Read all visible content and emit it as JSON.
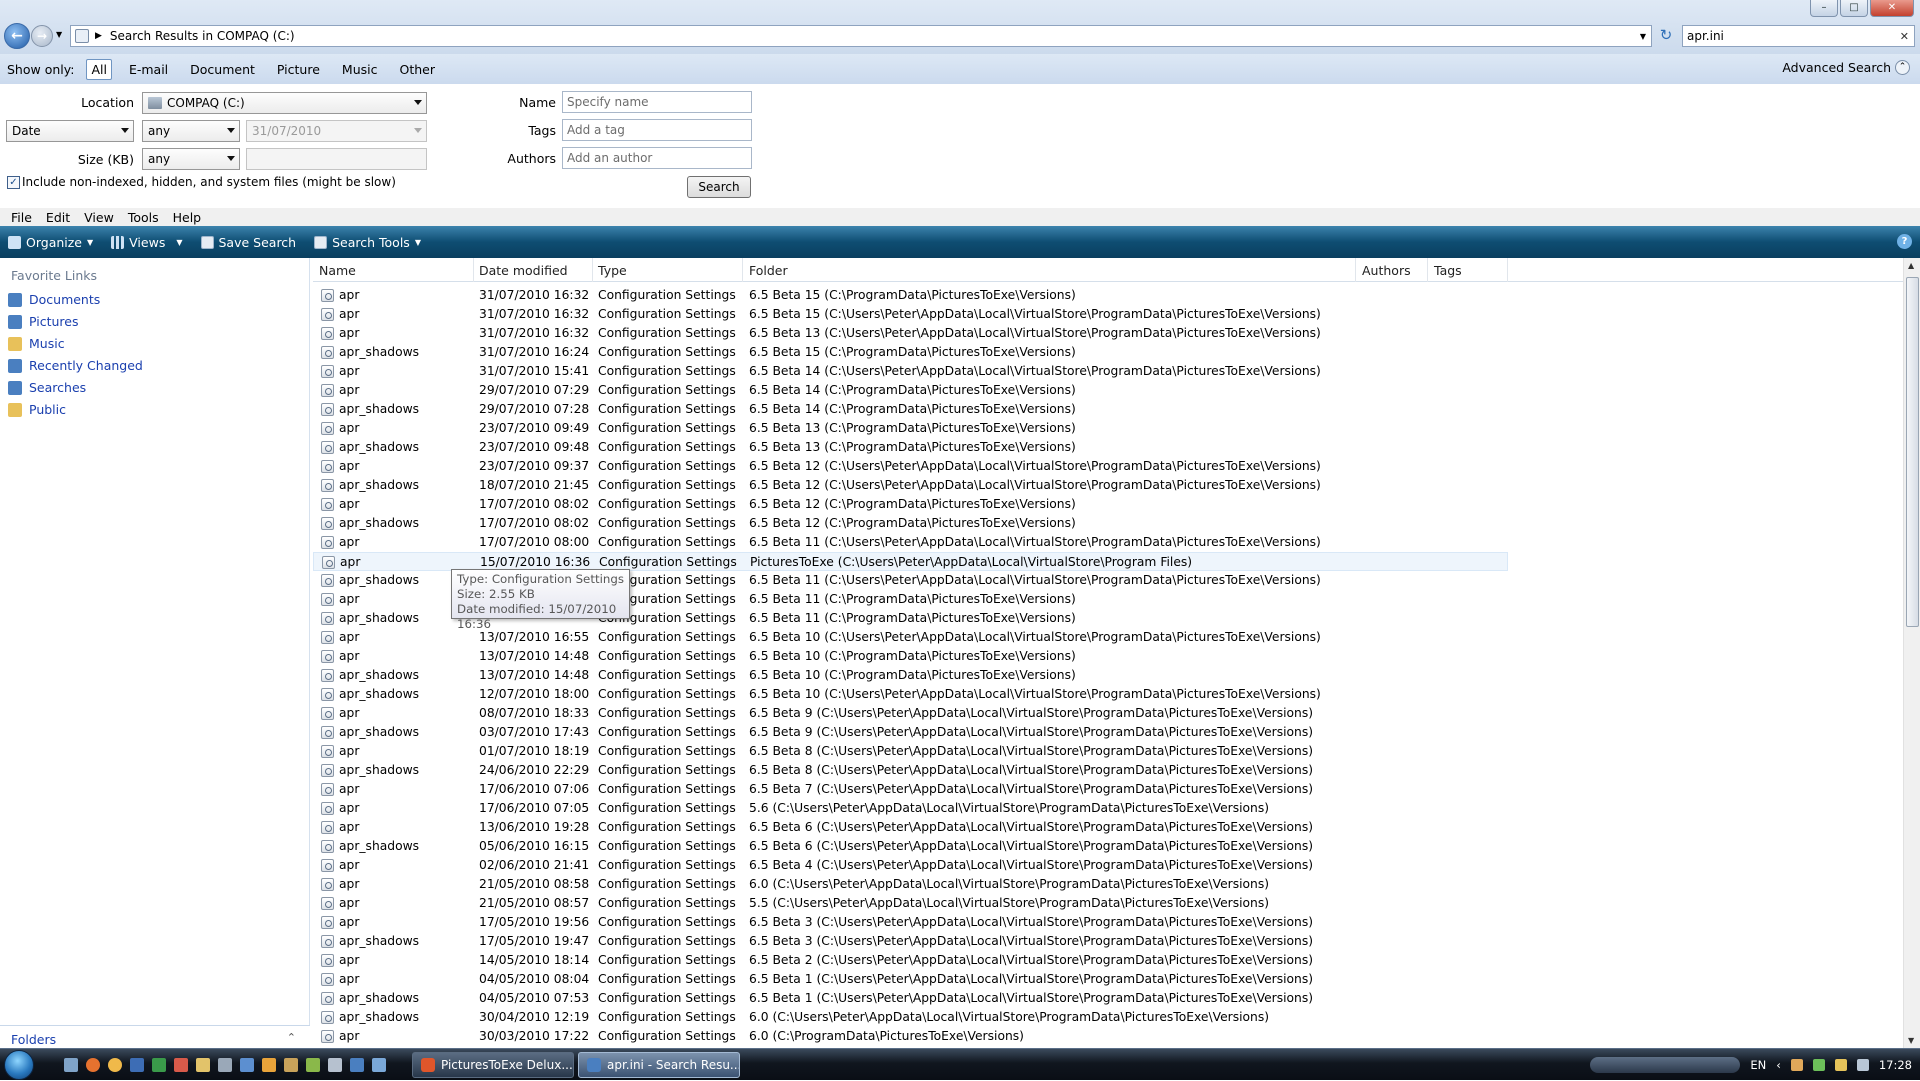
{
  "window": {
    "title": "Search Results in COMPAQ (C:)",
    "search_query": "apr.ini"
  },
  "filters": {
    "label": "Show only:",
    "items": [
      "All",
      "E-mail",
      "Document",
      "Picture",
      "Music",
      "Other"
    ],
    "selected": "All",
    "advanced": "Advanced Search"
  },
  "advanced": {
    "location_label": "Location",
    "location_value": "COMPAQ (C:)",
    "date_field": "Date",
    "date_op": "any",
    "date_value": "31/07/2010",
    "size_label": "Size (KB)",
    "size_op": "any",
    "size_value": "",
    "checkbox_label": "Include non-indexed, hidden, and system files (might be slow)",
    "checkbox_checked": true,
    "name_label": "Name",
    "name_placeholder": "Specify name",
    "tags_label": "Tags",
    "tags_placeholder": "Add a tag",
    "authors_label": "Authors",
    "authors_placeholder": "Add an author",
    "search_button": "Search"
  },
  "menu": [
    "File",
    "Edit",
    "View",
    "Tools",
    "Help"
  ],
  "toolbar": {
    "organize": "Organize",
    "views": "Views",
    "save_search": "Save Search",
    "search_tools": "Search Tools"
  },
  "sidebar": {
    "heading": "Favorite Links",
    "items": [
      {
        "label": "Documents",
        "icon": "documents-icon",
        "color": "#4a7fc0"
      },
      {
        "label": "Pictures",
        "icon": "pictures-icon",
        "color": "#4a7fc0"
      },
      {
        "label": "Music",
        "icon": "music-icon",
        "color": "#e8c15a"
      },
      {
        "label": "Recently Changed",
        "icon": "recently-changed-icon",
        "color": "#4a7fc0"
      },
      {
        "label": "Searches",
        "icon": "searches-icon",
        "color": "#4a7fc0"
      },
      {
        "label": "Public",
        "icon": "public-folder-icon",
        "color": "#e8c15a"
      }
    ],
    "folders": "Folders"
  },
  "columns": [
    "Name",
    "Date modified",
    "Type",
    "Folder",
    "Authors",
    "Tags"
  ],
  "rows": [
    {
      "name": "apr",
      "date": "31/07/2010 16:32",
      "type": "Configuration Settings",
      "folder": "6.5 Beta 15 (C:\\ProgramData\\PicturesToExe\\Versions)"
    },
    {
      "name": "apr",
      "date": "31/07/2010 16:32",
      "type": "Configuration Settings",
      "folder": "6.5 Beta 15 (C:\\Users\\Peter\\AppData\\Local\\VirtualStore\\ProgramData\\PicturesToExe\\Versions)"
    },
    {
      "name": "apr",
      "date": "31/07/2010 16:32",
      "type": "Configuration Settings",
      "folder": "6.5 Beta 13 (C:\\Users\\Peter\\AppData\\Local\\VirtualStore\\ProgramData\\PicturesToExe\\Versions)"
    },
    {
      "name": "apr_shadows",
      "date": "31/07/2010 16:24",
      "type": "Configuration Settings",
      "folder": "6.5 Beta 15 (C:\\ProgramData\\PicturesToExe\\Versions)"
    },
    {
      "name": "apr",
      "date": "31/07/2010 15:41",
      "type": "Configuration Settings",
      "folder": "6.5 Beta 14 (C:\\Users\\Peter\\AppData\\Local\\VirtualStore\\ProgramData\\PicturesToExe\\Versions)"
    },
    {
      "name": "apr",
      "date": "29/07/2010 07:29",
      "type": "Configuration Settings",
      "folder": "6.5 Beta 14 (C:\\ProgramData\\PicturesToExe\\Versions)"
    },
    {
      "name": "apr_shadows",
      "date": "29/07/2010 07:28",
      "type": "Configuration Settings",
      "folder": "6.5 Beta 14 (C:\\ProgramData\\PicturesToExe\\Versions)"
    },
    {
      "name": "apr",
      "date": "23/07/2010 09:49",
      "type": "Configuration Settings",
      "folder": "6.5 Beta 13 (C:\\ProgramData\\PicturesToExe\\Versions)"
    },
    {
      "name": "apr_shadows",
      "date": "23/07/2010 09:48",
      "type": "Configuration Settings",
      "folder": "6.5 Beta 13 (C:\\ProgramData\\PicturesToExe\\Versions)"
    },
    {
      "name": "apr",
      "date": "23/07/2010 09:37",
      "type": "Configuration Settings",
      "folder": "6.5 Beta 12 (C:\\Users\\Peter\\AppData\\Local\\VirtualStore\\ProgramData\\PicturesToExe\\Versions)"
    },
    {
      "name": "apr_shadows",
      "date": "18/07/2010 21:45",
      "type": "Configuration Settings",
      "folder": "6.5 Beta 12 (C:\\Users\\Peter\\AppData\\Local\\VirtualStore\\ProgramData\\PicturesToExe\\Versions)"
    },
    {
      "name": "apr",
      "date": "17/07/2010 08:02",
      "type": "Configuration Settings",
      "folder": "6.5 Beta 12 (C:\\ProgramData\\PicturesToExe\\Versions)"
    },
    {
      "name": "apr_shadows",
      "date": "17/07/2010 08:02",
      "type": "Configuration Settings",
      "folder": "6.5 Beta 12 (C:\\ProgramData\\PicturesToExe\\Versions)"
    },
    {
      "name": "apr",
      "date": "17/07/2010 08:00",
      "type": "Configuration Settings",
      "folder": "6.5 Beta 11 (C:\\Users\\Peter\\AppData\\Local\\VirtualStore\\ProgramData\\PicturesToExe\\Versions)"
    },
    {
      "name": "apr",
      "date": "15/07/2010 16:36",
      "type": "Configuration Settings",
      "folder": "PicturesToExe (C:\\Users\\Peter\\AppData\\Local\\VirtualStore\\Program Files)"
    },
    {
      "name": "apr_shadows",
      "date": "",
      "type": "Configuration Settings",
      "folder": "6.5 Beta 11 (C:\\Users\\Peter\\AppData\\Local\\VirtualStore\\ProgramData\\PicturesToExe\\Versions)"
    },
    {
      "name": "apr",
      "date": "",
      "type": "Configuration Settings",
      "folder": "6.5 Beta 11 (C:\\ProgramData\\PicturesToExe\\Versions)"
    },
    {
      "name": "apr_shadows",
      "date": "",
      "type": "Configuration Settings",
      "folder": "6.5 Beta 11 (C:\\ProgramData\\PicturesToExe\\Versions)"
    },
    {
      "name": "apr",
      "date": "13/07/2010 16:55",
      "type": "Configuration Settings",
      "folder": "6.5 Beta 10 (C:\\Users\\Peter\\AppData\\Local\\VirtualStore\\ProgramData\\PicturesToExe\\Versions)"
    },
    {
      "name": "apr",
      "date": "13/07/2010 14:48",
      "type": "Configuration Settings",
      "folder": "6.5 Beta 10 (C:\\ProgramData\\PicturesToExe\\Versions)"
    },
    {
      "name": "apr_shadows",
      "date": "13/07/2010 14:48",
      "type": "Configuration Settings",
      "folder": "6.5 Beta 10 (C:\\ProgramData\\PicturesToExe\\Versions)"
    },
    {
      "name": "apr_shadows",
      "date": "12/07/2010 18:00",
      "type": "Configuration Settings",
      "folder": "6.5 Beta 10 (C:\\Users\\Peter\\AppData\\Local\\VirtualStore\\ProgramData\\PicturesToExe\\Versions)"
    },
    {
      "name": "apr",
      "date": "08/07/2010 18:33",
      "type": "Configuration Settings",
      "folder": "6.5 Beta 9 (C:\\Users\\Peter\\AppData\\Local\\VirtualStore\\ProgramData\\PicturesToExe\\Versions)"
    },
    {
      "name": "apr_shadows",
      "date": "03/07/2010 17:43",
      "type": "Configuration Settings",
      "folder": "6.5 Beta 9 (C:\\Users\\Peter\\AppData\\Local\\VirtualStore\\ProgramData\\PicturesToExe\\Versions)"
    },
    {
      "name": "apr",
      "date": "01/07/2010 18:19",
      "type": "Configuration Settings",
      "folder": "6.5 Beta 8 (C:\\Users\\Peter\\AppData\\Local\\VirtualStore\\ProgramData\\PicturesToExe\\Versions)"
    },
    {
      "name": "apr_shadows",
      "date": "24/06/2010 22:29",
      "type": "Configuration Settings",
      "folder": "6.5 Beta 8 (C:\\Users\\Peter\\AppData\\Local\\VirtualStore\\ProgramData\\PicturesToExe\\Versions)"
    },
    {
      "name": "apr",
      "date": "17/06/2010 07:06",
      "type": "Configuration Settings",
      "folder": "6.5 Beta 7 (C:\\Users\\Peter\\AppData\\Local\\VirtualStore\\ProgramData\\PicturesToExe\\Versions)"
    },
    {
      "name": "apr",
      "date": "17/06/2010 07:05",
      "type": "Configuration Settings",
      "folder": "5.6 (C:\\Users\\Peter\\AppData\\Local\\VirtualStore\\ProgramData\\PicturesToExe\\Versions)"
    },
    {
      "name": "apr",
      "date": "13/06/2010 19:28",
      "type": "Configuration Settings",
      "folder": "6.5 Beta 6 (C:\\Users\\Peter\\AppData\\Local\\VirtualStore\\ProgramData\\PicturesToExe\\Versions)"
    },
    {
      "name": "apr_shadows",
      "date": "05/06/2010 16:15",
      "type": "Configuration Settings",
      "folder": "6.5 Beta 6 (C:\\Users\\Peter\\AppData\\Local\\VirtualStore\\ProgramData\\PicturesToExe\\Versions)"
    },
    {
      "name": "apr",
      "date": "02/06/2010 21:41",
      "type": "Configuration Settings",
      "folder": "6.5 Beta 4 (C:\\Users\\Peter\\AppData\\Local\\VirtualStore\\ProgramData\\PicturesToExe\\Versions)"
    },
    {
      "name": "apr",
      "date": "21/05/2010 08:58",
      "type": "Configuration Settings",
      "folder": "6.0 (C:\\Users\\Peter\\AppData\\Local\\VirtualStore\\ProgramData\\PicturesToExe\\Versions)"
    },
    {
      "name": "apr",
      "date": "21/05/2010 08:57",
      "type": "Configuration Settings",
      "folder": "5.5 (C:\\Users\\Peter\\AppData\\Local\\VirtualStore\\ProgramData\\PicturesToExe\\Versions)"
    },
    {
      "name": "apr",
      "date": "17/05/2010 19:56",
      "type": "Configuration Settings",
      "folder": "6.5 Beta 3 (C:\\Users\\Peter\\AppData\\Local\\VirtualStore\\ProgramData\\PicturesToExe\\Versions)"
    },
    {
      "name": "apr_shadows",
      "date": "17/05/2010 19:47",
      "type": "Configuration Settings",
      "folder": "6.5 Beta 3 (C:\\Users\\Peter\\AppData\\Local\\VirtualStore\\ProgramData\\PicturesToExe\\Versions)"
    },
    {
      "name": "apr",
      "date": "14/05/2010 18:14",
      "type": "Configuration Settings",
      "folder": "6.5 Beta 2 (C:\\Users\\Peter\\AppData\\Local\\VirtualStore\\ProgramData\\PicturesToExe\\Versions)"
    },
    {
      "name": "apr",
      "date": "04/05/2010 08:04",
      "type": "Configuration Settings",
      "folder": "6.5 Beta 1 (C:\\Users\\Peter\\AppData\\Local\\VirtualStore\\ProgramData\\PicturesToExe\\Versions)"
    },
    {
      "name": "apr_shadows",
      "date": "04/05/2010 07:53",
      "type": "Configuration Settings",
      "folder": "6.5 Beta 1 (C:\\Users\\Peter\\AppData\\Local\\VirtualStore\\ProgramData\\PicturesToExe\\Versions)"
    },
    {
      "name": "apr_shadows",
      "date": "30/04/2010 12:19",
      "type": "Configuration Settings",
      "folder": "6.0 (C:\\Users\\Peter\\AppData\\Local\\VirtualStore\\ProgramData\\PicturesToExe\\Versions)"
    },
    {
      "name": "apr",
      "date": "30/03/2010 17:22",
      "type": "Configuration Settings",
      "folder": "6.0 (C:\\ProgramData\\PicturesToExe\\Versions)"
    }
  ],
  "highlighted_row": 14,
  "tooltip": {
    "type": "Type: Configuration Settings",
    "size": "Size: 2.55 KB",
    "date": "Date modified: 15/07/2010 16:36"
  },
  "taskbar": {
    "tasks": [
      {
        "label": "PicturesToExe Delux...",
        "icon": "picturestoexe-icon",
        "color": "#e0562b"
      },
      {
        "label": "apr.ini - Search Resu...",
        "icon": "search-folder-icon",
        "color": "#4a7fc0"
      }
    ],
    "language": "EN",
    "clock": "17:28"
  }
}
